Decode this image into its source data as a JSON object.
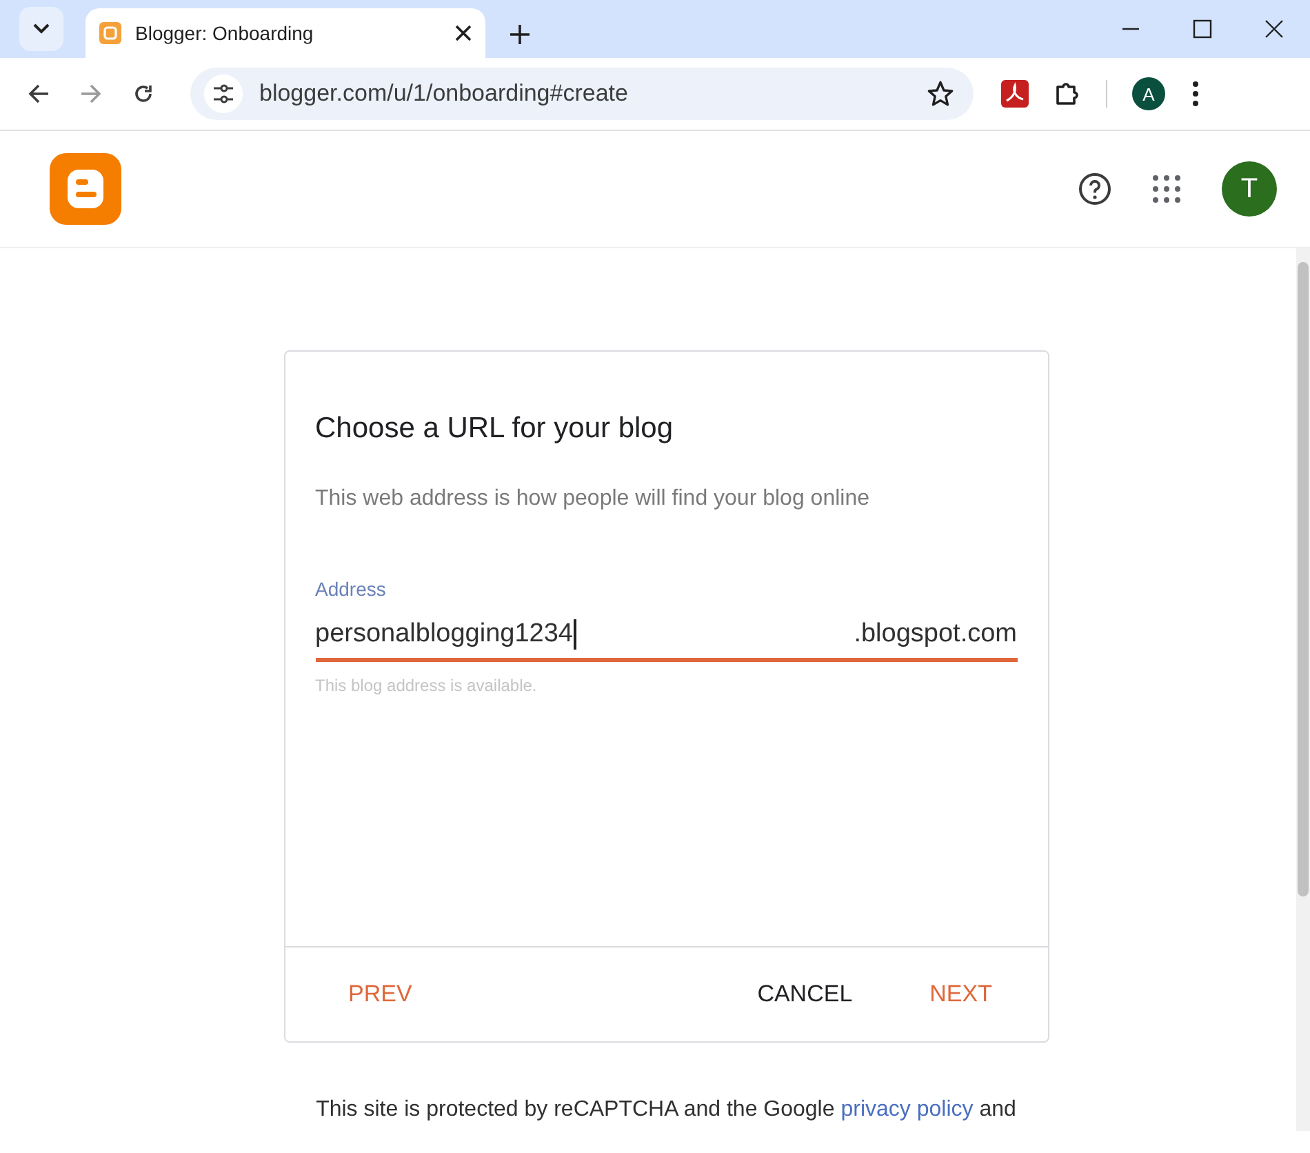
{
  "browser": {
    "tabs": [
      {
        "title": "Blogger: Onboarding",
        "selected": true
      }
    ],
    "address": "blogger.com/u/1/onboarding#create",
    "profile_initial": "A"
  },
  "header": {
    "avatar_initial": "T"
  },
  "dialog": {
    "title": "Choose a URL for your blog",
    "subtitle": "This web address is how people will find your blog online",
    "field": {
      "label": "Address",
      "value": "personalblogging1234",
      "suffix": ".blogspot.com",
      "helper": "This blog address is available."
    },
    "buttons": [
      {
        "label": "PREV",
        "kind": "accent"
      },
      {
        "label": "CANCEL",
        "kind": "plain"
      },
      {
        "label": "NEXT",
        "kind": "accent"
      }
    ]
  },
  "footer": {
    "text_before": "This site is protected by reCAPTCHA and the Google",
    "link": "privacy policy",
    "text_after": "and"
  }
}
